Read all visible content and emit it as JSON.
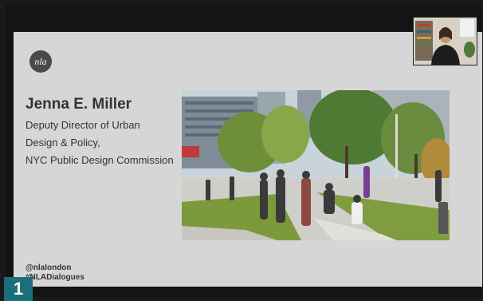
{
  "slide": {
    "logo_text": "nla",
    "speaker_name": "Jenna E. Miller",
    "role_lines": [
      "Deputy Director of Urban",
      "Design & Policy,",
      "NYC Public Design Commission"
    ],
    "handles": [
      "@nlalondon",
      "#NLADialogues"
    ],
    "photo_icon": "plaza-photo"
  },
  "video": {
    "participant_icon": "participant-video-tile"
  },
  "overlay": {
    "badge_number": "1",
    "badge_color": "#1c6f7a"
  }
}
